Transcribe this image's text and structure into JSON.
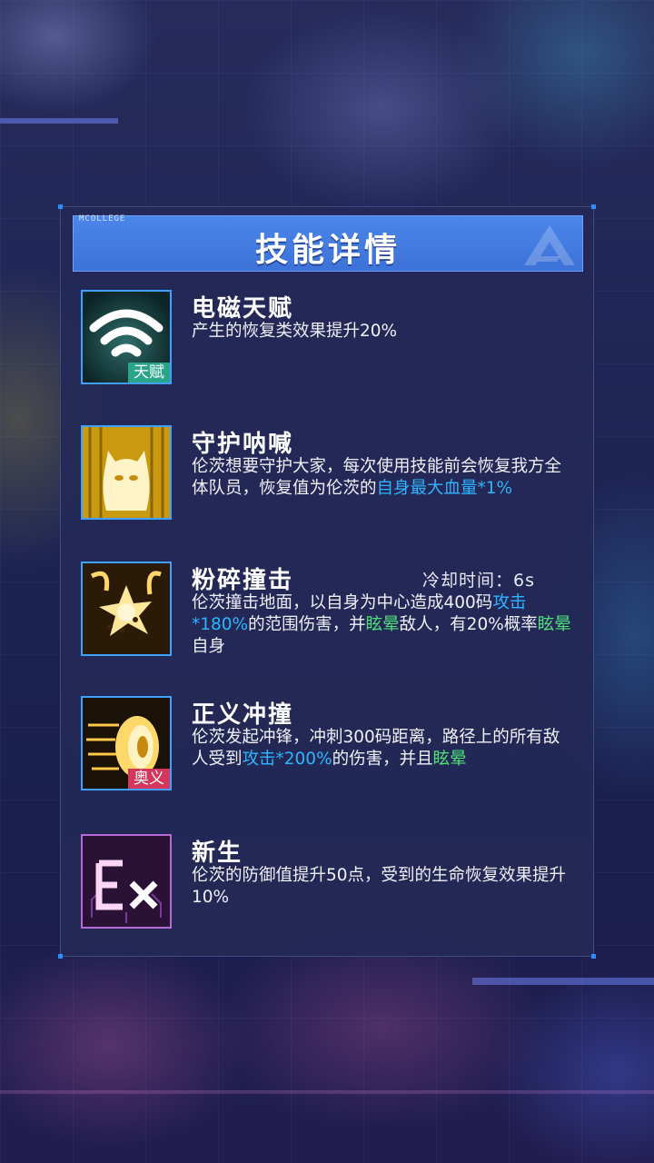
{
  "panel": {
    "title": "技能详情",
    "header_tag": "MCOLLEGE"
  },
  "skills": [
    {
      "name": "电磁天赋",
      "badge": "天赋",
      "icon": "wifi-signal-icon",
      "desc": [
        {
          "t": "产生的恢复类效果提升20%"
        }
      ]
    },
    {
      "name": "守护呐喊",
      "icon": "guardian-shout-icon",
      "desc": [
        {
          "t": "伦茨想要守护大家，每次使用技能前会恢复我方全体队员，恢复值为伦茨的"
        },
        {
          "t": "自身最大血量*1%",
          "c": "blue"
        }
      ]
    },
    {
      "name": "粉碎撞击",
      "cooldown": "冷却时间：6s",
      "icon": "smash-impact-icon",
      "desc": [
        {
          "t": "伦茨撞击地面，以自身为中心造成400码"
        },
        {
          "t": "攻击*180%",
          "c": "blue"
        },
        {
          "t": "的范围伤害，并"
        },
        {
          "t": "眩晕",
          "c": "green"
        },
        {
          "t": "敌人，有20%概率"
        },
        {
          "t": "眩晕",
          "c": "green"
        },
        {
          "t": "自身"
        }
      ]
    },
    {
      "name": "正义冲撞",
      "badge": "奥义",
      "icon": "charge-dash-icon",
      "desc": [
        {
          "t": "伦茨发起冲锋，冲刺300码距离，路径上的所有敌人受到"
        },
        {
          "t": "攻击*200%",
          "c": "blue"
        },
        {
          "t": "的伤害，并且"
        },
        {
          "t": "眩晕",
          "c": "green"
        }
      ]
    },
    {
      "name": "新生",
      "icon": "ex-rebirth-icon",
      "desc": [
        {
          "t": "伦茨的防御值提升50点，受到的生命恢复效果提升10%"
        }
      ]
    }
  ],
  "colors": {
    "highlight_blue": "#2fb4ff",
    "highlight_green": "#4fe07a",
    "header_blue": "#4b86ea",
    "talent_badge": "#2aa58a",
    "ultimate_badge": "#d4365c"
  }
}
